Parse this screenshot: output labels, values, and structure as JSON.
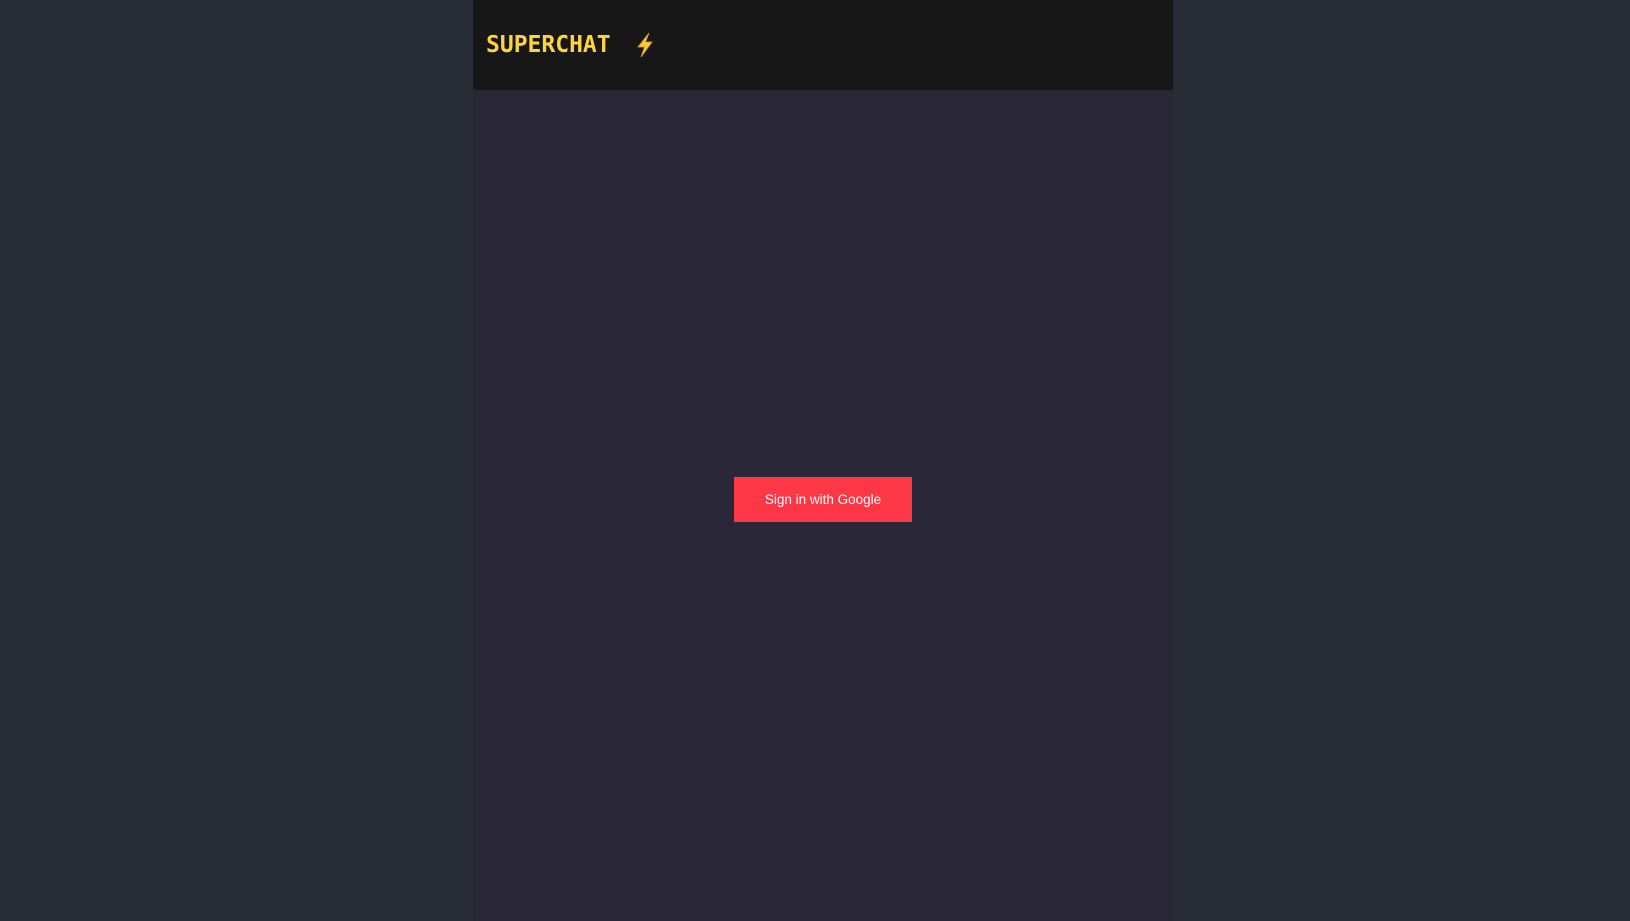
{
  "header": {
    "title": "SUPERCHAT",
    "logo_icon": "lightning-bolt-icon"
  },
  "main": {
    "signin_label": "Sign in with Google"
  },
  "colors": {
    "page_background": "#282c34",
    "app_background": "#282637",
    "header_background": "#181717",
    "title_color": "#ffd43b",
    "button_color": "#fd3745",
    "bolt_color": "#f7c843"
  }
}
